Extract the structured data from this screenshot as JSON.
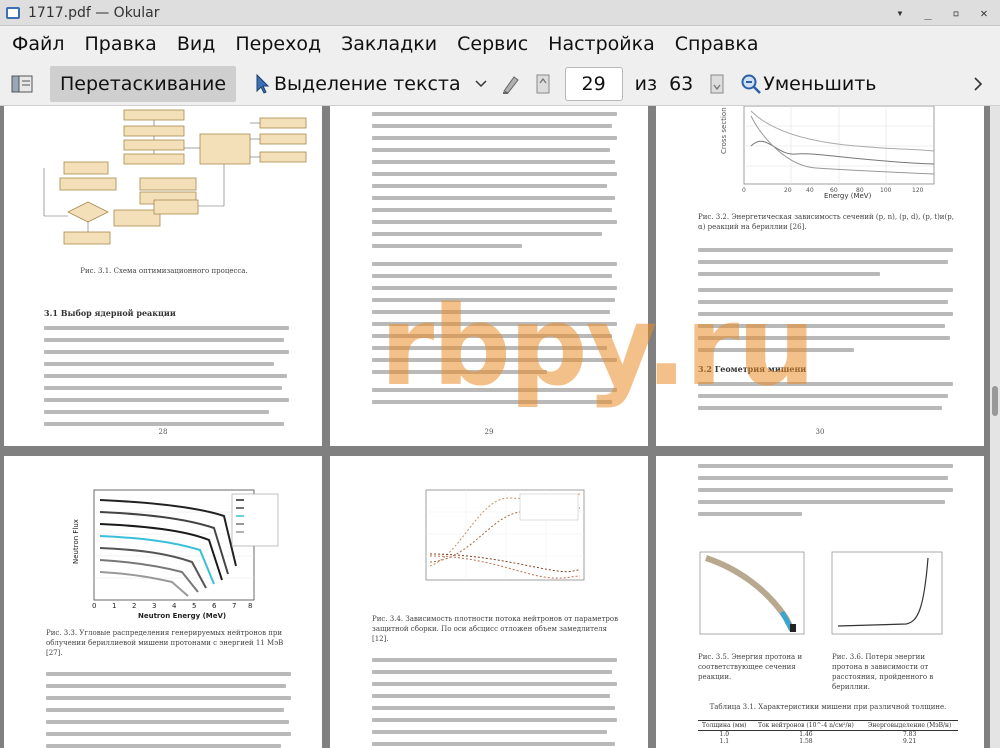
{
  "window": {
    "title": "1717.pdf  — Okular"
  },
  "menu": [
    "Файл",
    "Правка",
    "Вид",
    "Переход",
    "Закладки",
    "Сервис",
    "Настройка",
    "Справка"
  ],
  "toolbar": {
    "browse_label": "Перетаскивание",
    "select_label": "Выделение текста",
    "page_current": "29",
    "page_of": "из",
    "page_total": "63",
    "zoom_out_label": "Уменьшить"
  },
  "pages": {
    "p28": {
      "number": "28",
      "caption": "Рис. 3.1. Схема оптимизационного процесса.",
      "section": "3.1    Выбор ядерной реакции"
    },
    "p29": {
      "number": "29"
    },
    "p30": {
      "number": "30",
      "caption": "Рис. 3.2. Энергетическая зависимость сечений (p, n), (p, d), (p, t)и(p, α) реакций на бериллии [26].",
      "section": "3.2    Геометрия мишени",
      "axis_label": "Energy (MeV)"
    },
    "p31": {
      "caption": "Рис. 3.3. Угловые распределения генерируемых нейтронов при облучении бериллиевой мишени протонами с энергией 11 МэВ [27].",
      "axis_label": "Neutron Energy (MeV)"
    },
    "p32": {
      "caption": "Рис. 3.4. Зависимость плотности потока нейтронов от параметров защитной сборки. По оси абсцисс отложен объем замедлителя [12]."
    },
    "p33": {
      "caption_a": "Рис. 3.5. Энергия протона и соответствующее сечения реакции.",
      "caption_b": "Рис. 3.6. Потеря энергии протона в зависимости от расстояния, пройденного в бериллии.",
      "table_title": "Таблица 3.1. Характеристики мишени при различной толщине.",
      "table_headers": [
        "Толщина (мм)",
        "Ток нейтронов (10^-4 n/см²/н)",
        "Энерговыделение (МэВ/н)"
      ],
      "table_rows": [
        [
          "1.0",
          "1.46",
          "7.83"
        ],
        [
          "1.1",
          "1.58",
          "9.21"
        ]
      ]
    }
  },
  "watermark": "rbpy.ru"
}
